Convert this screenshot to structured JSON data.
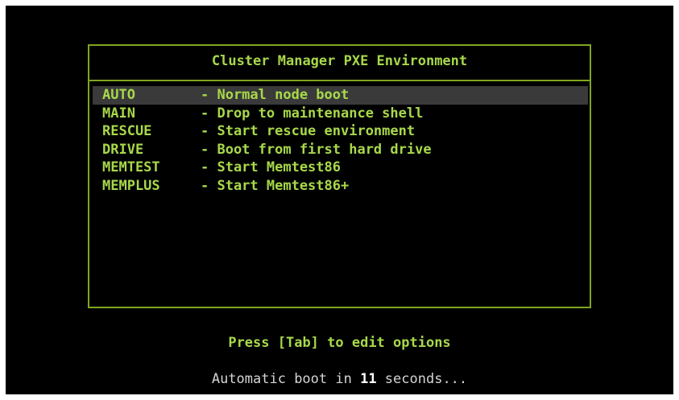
{
  "menu": {
    "title": "Cluster Manager PXE Environment",
    "selected_index": 0,
    "entries": [
      {
        "label": "AUTO",
        "description": "- Normal node boot"
      },
      {
        "label": "MAIN",
        "description": "- Drop to maintenance shell"
      },
      {
        "label": "RESCUE",
        "description": "- Start rescue environment"
      },
      {
        "label": "DRIVE",
        "description": "- Boot from first hard drive"
      },
      {
        "label": "MEMTEST",
        "description": "- Start Memtest86"
      },
      {
        "label": "MEMPLUS",
        "description": "- Start Memtest86+"
      }
    ]
  },
  "footer": {
    "hint": "Press [Tab] to edit options",
    "countdown_prefix": "Automatic boot in ",
    "countdown_seconds": "11",
    "countdown_suffix": " seconds..."
  },
  "colors": {
    "background": "#000000",
    "border": "#7fa61e",
    "text": "#a8d84a",
    "selection": "#3a3a3a",
    "countdown_text": "#d4d4d4"
  }
}
